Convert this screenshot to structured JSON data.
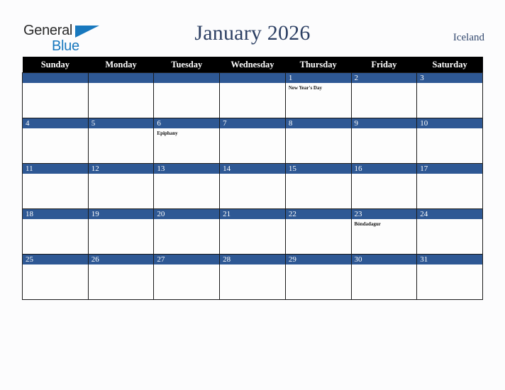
{
  "brand": {
    "line1": "General",
    "line2": "Blue",
    "triangle_icon": "blue-triangle-icon",
    "color_dark": "#2b2b2b",
    "color_blue": "#1878be"
  },
  "header": {
    "title": "January 2026",
    "country": "Iceland",
    "title_color": "#2c3f63"
  },
  "calendar": {
    "weekday_headers": [
      "Sunday",
      "Monday",
      "Tuesday",
      "Wednesday",
      "Thursday",
      "Friday",
      "Saturday"
    ],
    "header_bg": "#000000",
    "daynum_bg": "#2e5894",
    "cell_bg": "#fdfdfd",
    "weeks": [
      [
        {
          "day": "",
          "events": []
        },
        {
          "day": "",
          "events": []
        },
        {
          "day": "",
          "events": []
        },
        {
          "day": "",
          "events": []
        },
        {
          "day": "1",
          "events": [
            "New Year's Day"
          ]
        },
        {
          "day": "2",
          "events": []
        },
        {
          "day": "3",
          "events": []
        }
      ],
      [
        {
          "day": "4",
          "events": []
        },
        {
          "day": "5",
          "events": []
        },
        {
          "day": "6",
          "events": [
            "Epiphany"
          ]
        },
        {
          "day": "7",
          "events": []
        },
        {
          "day": "8",
          "events": []
        },
        {
          "day": "9",
          "events": []
        },
        {
          "day": "10",
          "events": []
        }
      ],
      [
        {
          "day": "11",
          "events": []
        },
        {
          "day": "12",
          "events": []
        },
        {
          "day": "13",
          "events": []
        },
        {
          "day": "14",
          "events": []
        },
        {
          "day": "15",
          "events": []
        },
        {
          "day": "16",
          "events": []
        },
        {
          "day": "17",
          "events": []
        }
      ],
      [
        {
          "day": "18",
          "events": []
        },
        {
          "day": "19",
          "events": []
        },
        {
          "day": "20",
          "events": []
        },
        {
          "day": "21",
          "events": []
        },
        {
          "day": "22",
          "events": []
        },
        {
          "day": "23",
          "events": [
            "Bóndadagur"
          ]
        },
        {
          "day": "24",
          "events": []
        }
      ],
      [
        {
          "day": "25",
          "events": []
        },
        {
          "day": "26",
          "events": []
        },
        {
          "day": "27",
          "events": []
        },
        {
          "day": "28",
          "events": []
        },
        {
          "day": "29",
          "events": []
        },
        {
          "day": "30",
          "events": []
        },
        {
          "day": "31",
          "events": []
        }
      ]
    ]
  }
}
